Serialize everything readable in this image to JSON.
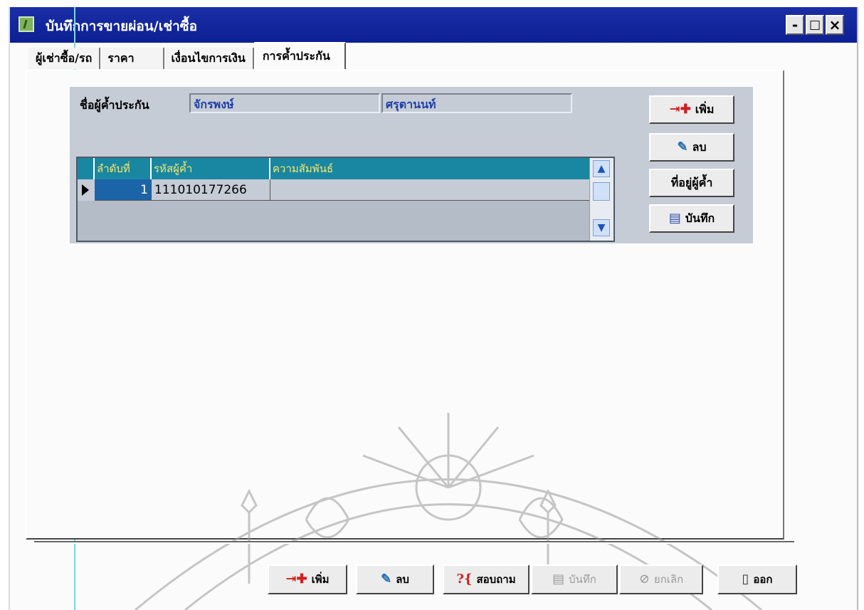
{
  "window": {
    "title": "บันทึกการขายผ่อน/เช่าซื้อ",
    "controls": {
      "minimize": "-",
      "maximize": "□",
      "close": "×"
    }
  },
  "tabs": [
    {
      "label": "ผู้เช่าซื้อ/รถ"
    },
    {
      "label": "ราคา"
    },
    {
      "label": "เงื่อนไขการเงิน"
    },
    {
      "label": "การค้ำประกัน"
    }
  ],
  "guarantor": {
    "label": "ชื่อผู้ค้ำประกัน",
    "first_name": "จักรพงษ์",
    "last_name": "ศรุตานนท์"
  },
  "grid": {
    "columns": [
      "ลำดับที่",
      "รหัสผู้ค้ำ",
      "ความสัมพันธ์"
    ],
    "rows": [
      {
        "seq": "1",
        "code": "111010177266",
        "relation": ""
      }
    ]
  },
  "side_buttons": {
    "add": "เพิ่ม",
    "delete": "ลบ",
    "address": "ที่อยู่ผู้ค้ำ",
    "save": "บันทึก"
  },
  "bottom_buttons": {
    "add": "เพิ่ม",
    "delete": "ลบ",
    "query": "สอบถาม",
    "save": "บันทึก",
    "cancel": "ยกเลิก",
    "exit": "ออก"
  },
  "icons": {
    "app": "app-icon",
    "add": "add-icon",
    "delete": "delete-icon",
    "save": "save-icon",
    "query": "query-icon",
    "cancel": "cancel-icon",
    "exit": "exit-door-icon"
  },
  "colors": {
    "titlebar": "#0d1f94",
    "grid_header": "#1a87a2",
    "grid_header_text": "#f7e86b",
    "panel": "#c6ccd6",
    "field_text": "#1d3ea6"
  }
}
